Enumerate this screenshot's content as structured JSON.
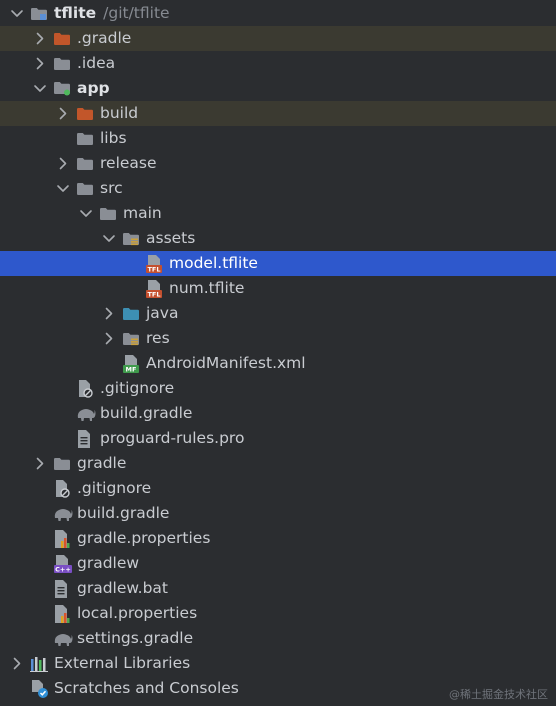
{
  "project": {
    "name": "tflite",
    "path": "/git/tflite"
  },
  "tree": [
    {
      "label": "tflite",
      "hint": "/git/tflite",
      "level": 0,
      "icon": "module-folder-icon",
      "expanded": true,
      "bold": true
    },
    {
      "label": ".gradle",
      "level": 1,
      "icon": "excluded-folder-icon",
      "expanded": false,
      "highlighted": true
    },
    {
      "label": ".idea",
      "level": 1,
      "icon": "folder-icon",
      "expanded": false
    },
    {
      "label": "app",
      "level": 1,
      "icon": "app-module-icon",
      "expanded": true,
      "bold": true
    },
    {
      "label": "build",
      "level": 2,
      "icon": "excluded-folder-icon",
      "expanded": false,
      "highlighted": true
    },
    {
      "label": "libs",
      "level": 2,
      "icon": "folder-icon"
    },
    {
      "label": "release",
      "level": 2,
      "icon": "folder-icon",
      "expanded": false
    },
    {
      "label": "src",
      "level": 2,
      "icon": "folder-icon",
      "expanded": true
    },
    {
      "label": "main",
      "level": 3,
      "icon": "folder-icon",
      "expanded": true
    },
    {
      "label": "assets",
      "level": 4,
      "icon": "resources-folder-icon",
      "expanded": true
    },
    {
      "label": "model.tflite",
      "level": 5,
      "icon": "tflite-file-icon",
      "selected": true
    },
    {
      "label": "num.tflite",
      "level": 5,
      "icon": "tflite-file-icon"
    },
    {
      "label": "java",
      "level": 4,
      "icon": "source-folder-icon",
      "expanded": false
    },
    {
      "label": "res",
      "level": 4,
      "icon": "resources-folder-icon",
      "expanded": false
    },
    {
      "label": "AndroidManifest.xml",
      "level": 4,
      "icon": "manifest-file-icon"
    },
    {
      "label": ".gitignore",
      "level": 2,
      "icon": "ignore-file-icon"
    },
    {
      "label": "build.gradle",
      "level": 2,
      "icon": "gradle-elephant-icon"
    },
    {
      "label": "proguard-rules.pro",
      "level": 2,
      "icon": "text-file-icon"
    },
    {
      "label": "gradle",
      "level": 1,
      "icon": "folder-icon",
      "expanded": false
    },
    {
      "label": ".gitignore",
      "level": 1,
      "icon": "ignore-file-icon"
    },
    {
      "label": "build.gradle",
      "level": 1,
      "icon": "gradle-elephant-icon"
    },
    {
      "label": "gradle.properties",
      "level": 1,
      "icon": "properties-file-icon"
    },
    {
      "label": "gradlew",
      "level": 1,
      "icon": "shell-script-icon"
    },
    {
      "label": "gradlew.bat",
      "level": 1,
      "icon": "text-file-icon"
    },
    {
      "label": "local.properties",
      "level": 1,
      "icon": "properties-file-icon"
    },
    {
      "label": "settings.gradle",
      "level": 1,
      "icon": "gradle-elephant-icon"
    },
    {
      "label": "External Libraries",
      "level": 0,
      "icon": "libraries-icon",
      "expanded": false
    },
    {
      "label": "Scratches and Consoles",
      "level": 0,
      "icon": "scratches-icon"
    }
  ],
  "watermark": "@稀土掘金技术社区",
  "colors": {
    "background": "#2b2d30",
    "selection": "#2e58cc",
    "excluded_highlight": "#3b3a31",
    "excluded_folder": "#c2562a",
    "folder": "#8a8e95",
    "source_folder": "#3d8fb3"
  }
}
